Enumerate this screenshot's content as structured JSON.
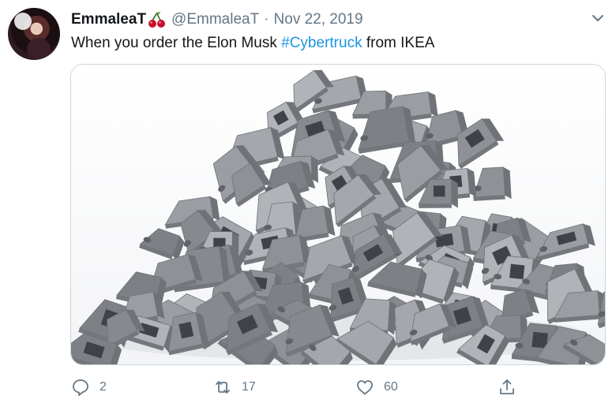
{
  "tweet": {
    "display_name": "EmmaleaT",
    "handle": "@EmmaleaT",
    "separator": "·",
    "date": "Nov 22, 2019",
    "text_before": "When you order the Elon Musk ",
    "hashtag": "#Cybertruck",
    "text_after": " from IKEA",
    "name_emoji_icon": "cherry-icon",
    "menu_icon": "chevron-down-icon"
  },
  "media": {
    "alt": "Pile of grey sloped LEGO bricks"
  },
  "actions": {
    "reply_count": "2",
    "retweet_count": "17",
    "like_count": "60"
  },
  "colors": {
    "link": "#1b95e0",
    "secondary_text": "#657786",
    "border": "#ccd6dd"
  }
}
